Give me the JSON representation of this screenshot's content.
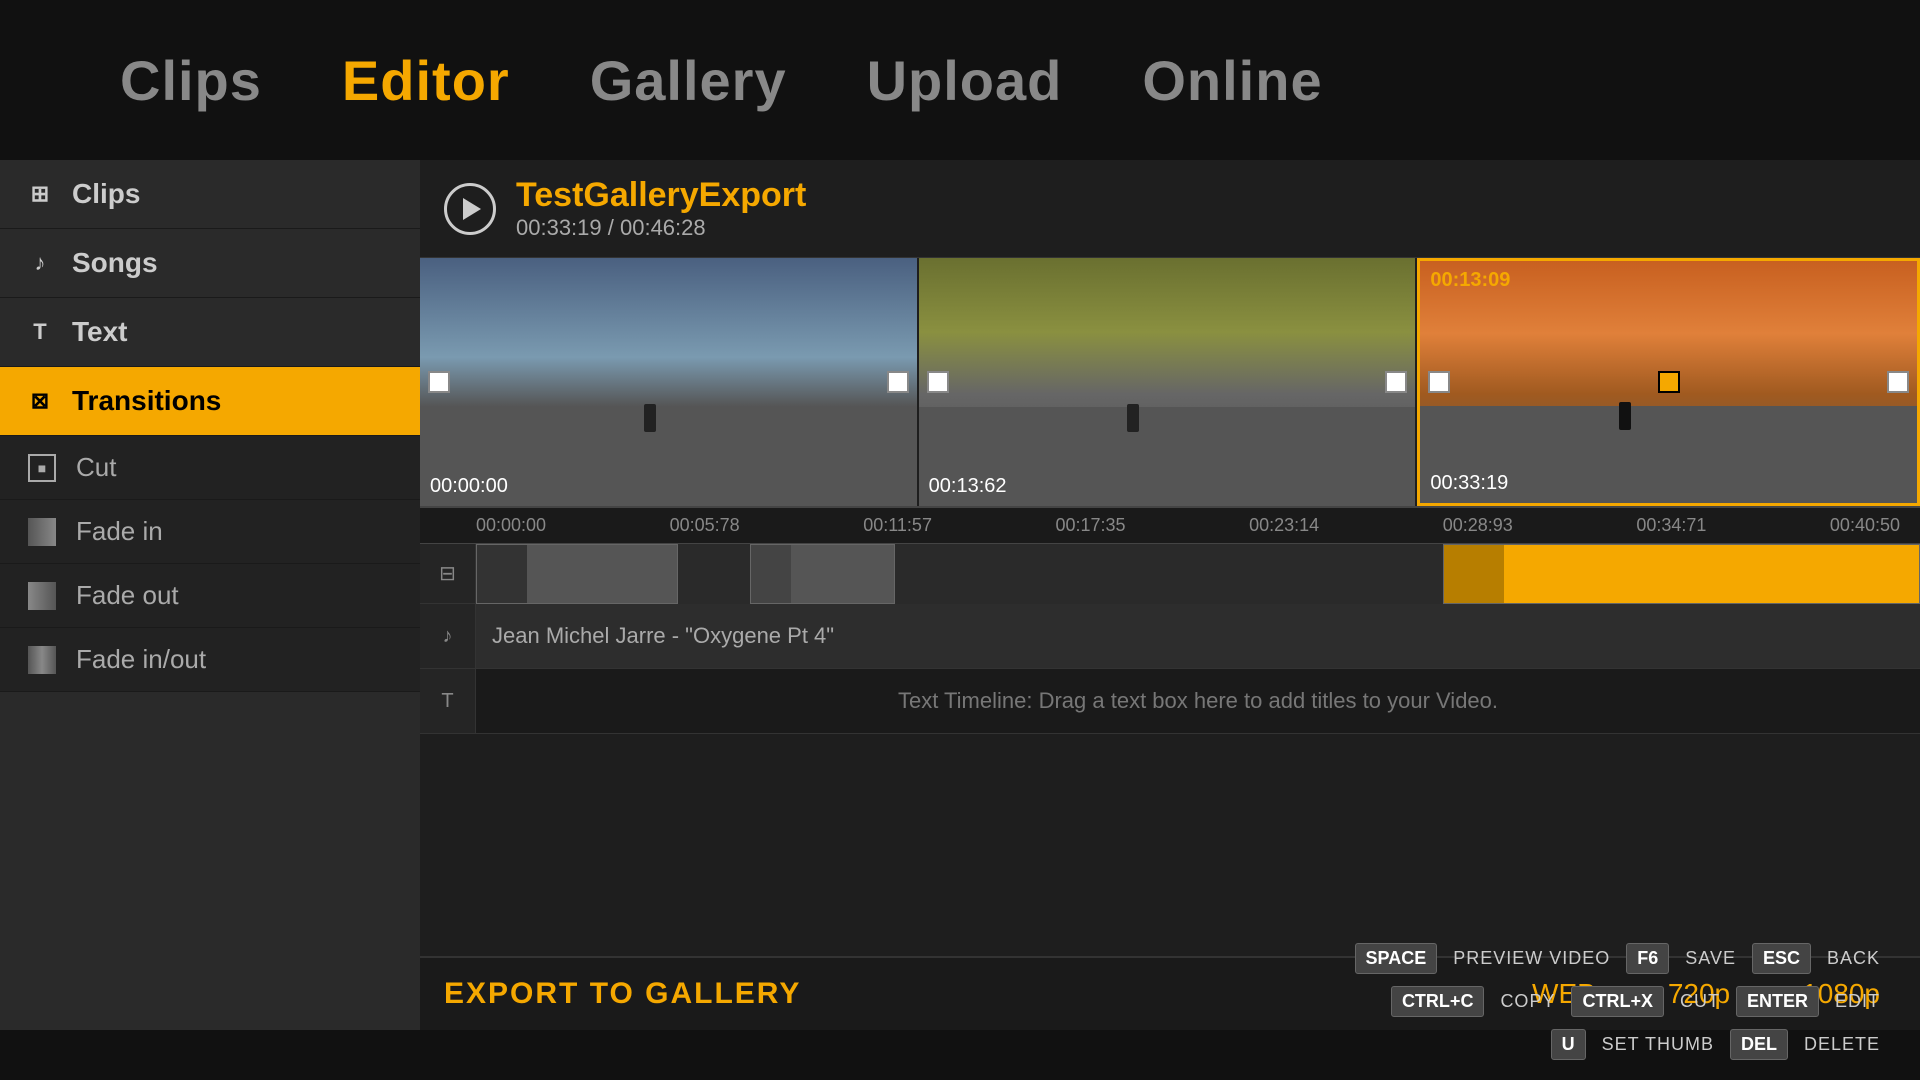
{
  "nav": {
    "items": [
      {
        "label": "Clips",
        "active": false
      },
      {
        "label": "Editor",
        "active": true
      },
      {
        "label": "Gallery",
        "active": false
      },
      {
        "label": "Upload",
        "active": false
      },
      {
        "label": "Online",
        "active": false
      }
    ]
  },
  "sidebar": {
    "items": [
      {
        "label": "Clips",
        "icon": "⊞",
        "active": false
      },
      {
        "label": "Songs",
        "icon": "♪",
        "active": false
      },
      {
        "label": "Text",
        "icon": "T",
        "active": false
      },
      {
        "label": "Transitions",
        "icon": "⊠",
        "active": true
      }
    ],
    "transitions": [
      {
        "label": "Cut"
      },
      {
        "label": "Fade in"
      },
      {
        "label": "Fade out"
      },
      {
        "label": "Fade in/out"
      }
    ]
  },
  "video": {
    "title": "TestGalleryExport",
    "current_time": "00:33:19",
    "total_time": "00:46:28"
  },
  "clips": [
    {
      "time_top": "",
      "time_bottom": "00:00:00",
      "active": false
    },
    {
      "time_top": "",
      "time_bottom": "00:13:62",
      "active": false
    },
    {
      "time_top": "00:13:09",
      "time_bottom": "00:33:19",
      "active": true
    }
  ],
  "timeline": {
    "ruler": [
      "00:00:00",
      "00:05:78",
      "00:11:57",
      "00:17:35",
      "00:23:14",
      "00:28:93",
      "00:34:71",
      "00:40:50"
    ]
  },
  "music_track": {
    "label": "Jean Michel Jarre  - \"Oxygene Pt 4\""
  },
  "text_track": {
    "hint": "Text Timeline: Drag a text box here to add titles to your Video."
  },
  "export": {
    "label": "EXPORT TO GALLERY",
    "qualities": [
      "WEB",
      "720p",
      "1080p"
    ]
  },
  "shortcuts": {
    "row1": [
      {
        "kbd": "SPACE",
        "label": "PREVIEW VIDEO"
      },
      {
        "kbd": "F6",
        "label": "SAVE"
      },
      {
        "kbd": "ESC",
        "label": "BACK"
      }
    ],
    "row2": [
      {
        "kbd": "CTRL+C",
        "label": "COPY"
      },
      {
        "kbd": "CTRL+X",
        "label": "CUT"
      },
      {
        "kbd": "ENTER",
        "label": "EDIT"
      }
    ],
    "row3": [
      {
        "kbd": "U",
        "label": "SET THUMB"
      },
      {
        "kbd": "DEL",
        "label": "DELETE"
      }
    ]
  }
}
